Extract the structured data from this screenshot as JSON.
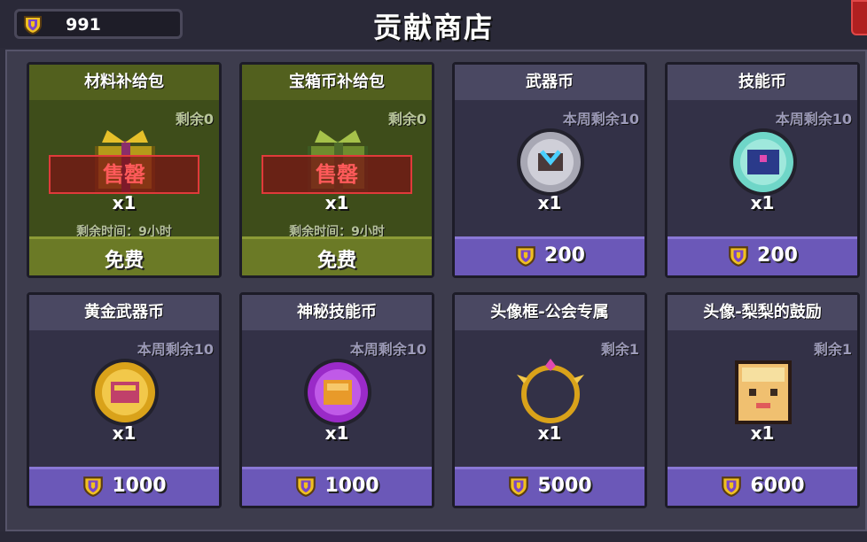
{
  "header": {
    "title": "贡献商店",
    "currency_value": "991"
  },
  "cards": [
    {
      "name": "材料补给包",
      "remain": "剩余0",
      "qty": "x1",
      "price": "免费",
      "timer": "剩余时间：9小时",
      "soldout": "售罄",
      "theme": "green",
      "icon": "gift-box-icon"
    },
    {
      "name": "宝箱币补给包",
      "remain": "剩余0",
      "qty": "x1",
      "price": "免费",
      "timer": "剩余时间：9小时",
      "soldout": "售罄",
      "theme": "green",
      "icon": "gift-box-green-icon"
    },
    {
      "name": "武器币",
      "remain": "本周剩余10",
      "qty": "x1",
      "price": "200",
      "icon": "weapon-coin-icon"
    },
    {
      "name": "技能币",
      "remain": "本周剩余10",
      "qty": "x1",
      "price": "200",
      "icon": "skill-coin-icon"
    },
    {
      "name": "黄金武器币",
      "remain": "本周剩余10",
      "qty": "x1",
      "price": "1000",
      "icon": "gold-weapon-coin-icon"
    },
    {
      "name": "神秘技能币",
      "remain": "本周剩余10",
      "qty": "x1",
      "price": "1000",
      "icon": "mystery-skill-coin-icon"
    },
    {
      "name": "头像框-公会专属",
      "remain": "剩余1",
      "qty": "x1",
      "price": "5000",
      "icon": "avatar-frame-icon"
    },
    {
      "name": "头像-梨梨的鼓励",
      "remain": "剩余1",
      "qty": "x1",
      "price": "6000",
      "icon": "avatar-portrait-icon"
    }
  ],
  "colors": {
    "accent": "#6b58b8",
    "green_card": "#3e4d1a",
    "soldout": "#e03a3a",
    "shield_gold": "#f0c020"
  }
}
